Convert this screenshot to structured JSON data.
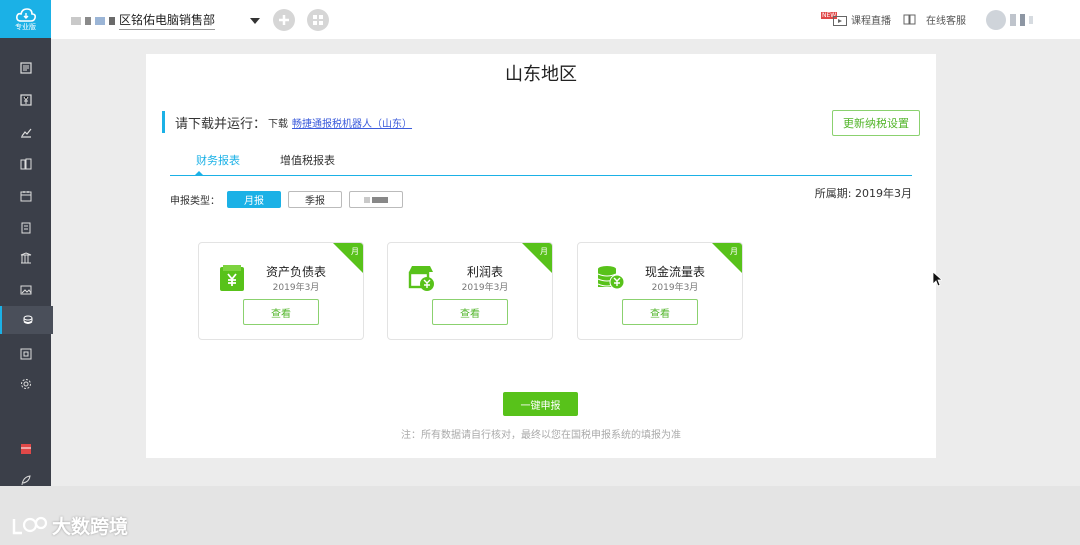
{
  "brand": {
    "label": "专业版"
  },
  "company": {
    "name": "区铭佑电脑销售部"
  },
  "topbar": {
    "live": "课程直播",
    "service": "在线客服",
    "new_badge": "NEW"
  },
  "page": {
    "title": "山东地区",
    "download_prefix": "请下载并运行：",
    "download_small": "下载",
    "download_link": "畅捷通报税机器人（山东）",
    "update_button": "更新纳税设置"
  },
  "tabs": [
    {
      "label": "财务报表"
    },
    {
      "label": "增值税报表"
    }
  ],
  "period": "所属期: 2019年3月",
  "report_type": {
    "label": "申报类型：",
    "options": [
      "月报",
      "季报"
    ],
    "selected": "月报"
  },
  "reports": [
    {
      "name": "资产负债表",
      "date": "2019年3月",
      "badge": "月",
      "view": "查看"
    },
    {
      "name": "利润表",
      "date": "2019年3月",
      "badge": "月",
      "view": "查看"
    },
    {
      "name": "现金流量表",
      "date": "2019年3月",
      "badge": "月",
      "view": "查看"
    }
  ],
  "one_key": "一键申报",
  "note": "注：所有数据请自行核对，最终以您在国税申报系统的填报为准",
  "watermark": "大数跨境",
  "colors": {
    "accent": "#1bb1e6",
    "green": "#58c21a",
    "sidebar": "#3b3f49"
  }
}
